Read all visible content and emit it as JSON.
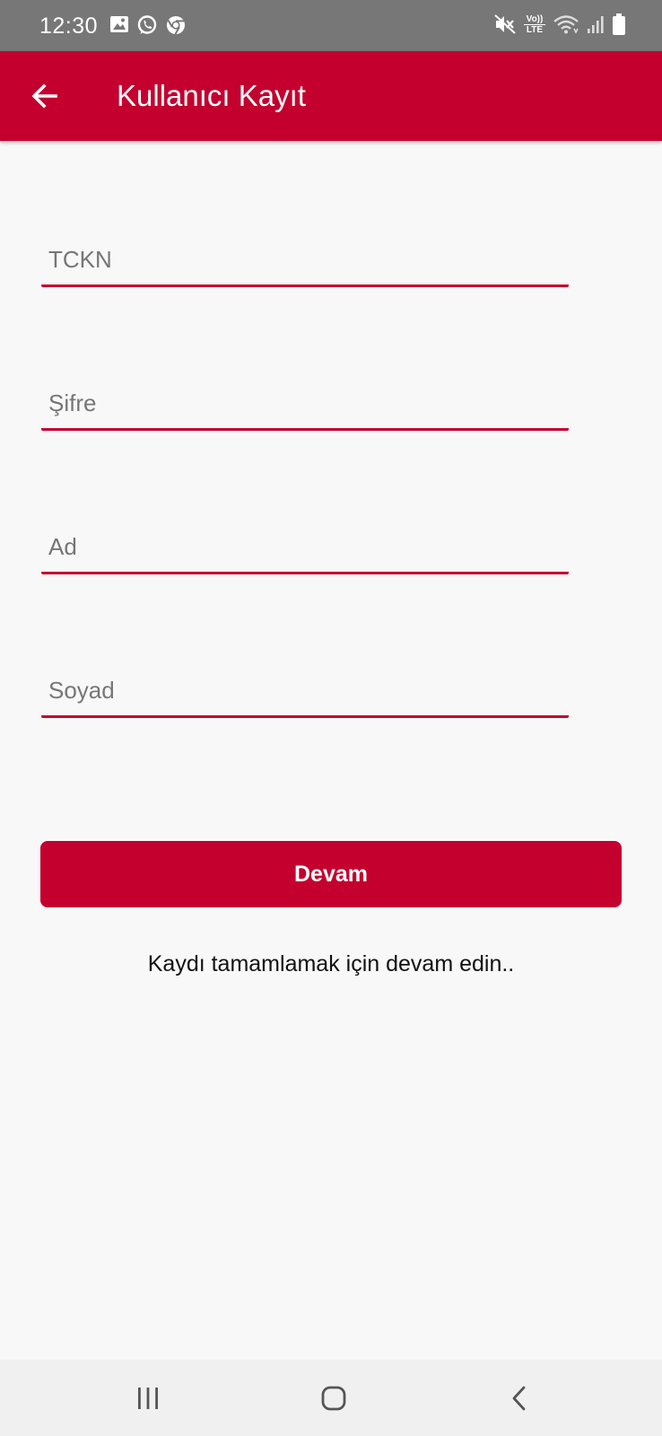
{
  "status_bar": {
    "time": "12:30",
    "left_icons": [
      "image-icon",
      "whatsapp-icon",
      "chrome-icon"
    ],
    "right_icons": [
      "muted-icon",
      "volte-lte-icon",
      "wifi-icon",
      "signal-icon",
      "battery-icon"
    ],
    "volte_top": "Vo))",
    "volte_bottom": "LTE"
  },
  "app_bar": {
    "title": "Kullanıcı Kayıt",
    "back_icon": "arrow-back-icon",
    "color": "#c4002f"
  },
  "form": {
    "fields": [
      {
        "name": "tckn",
        "placeholder": "TCKN",
        "value": ""
      },
      {
        "name": "sifre",
        "placeholder": "Şifre",
        "value": ""
      },
      {
        "name": "ad",
        "placeholder": "Ad",
        "value": ""
      },
      {
        "name": "soyad",
        "placeholder": "Soyad",
        "value": ""
      }
    ],
    "submit_label": "Devam",
    "hint": "Kaydı tamamlamak için devam edin.."
  },
  "nav_bar": {
    "icons": [
      "recents-icon",
      "home-icon",
      "back-icon"
    ]
  }
}
